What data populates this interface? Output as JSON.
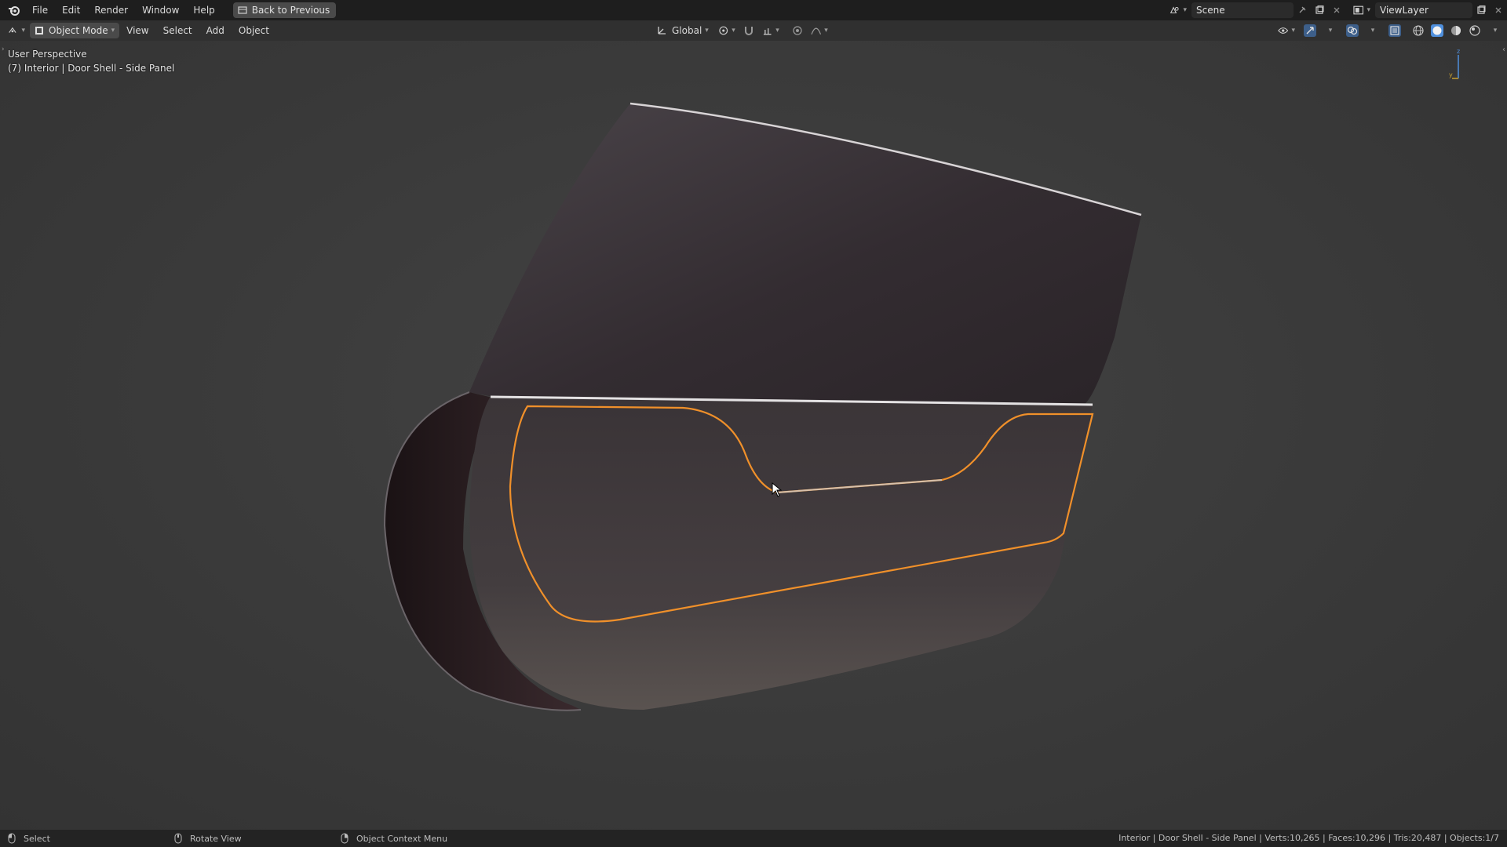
{
  "topbar": {
    "menus": [
      "File",
      "Edit",
      "Render",
      "Window",
      "Help"
    ],
    "back_button": "Back to Previous",
    "scene_name": "Scene",
    "view_layer": "ViewLayer"
  },
  "header": {
    "mode": "Object Mode",
    "menus": [
      "View",
      "Select",
      "Add",
      "Object"
    ],
    "transform_orientation": "Global"
  },
  "viewport": {
    "perspective_label": "User Perspective",
    "object_label": "(7) Interior | Door Shell - Side Panel",
    "gizmo_z": "z",
    "gizmo_y": "y"
  },
  "status": {
    "left_action": "Select",
    "middle_action": "Rotate View",
    "right_action": "Object Context Menu",
    "stats": "Interior | Door Shell - Side Panel | Verts:10,265 | Faces:10,296 | Tris:20,487 | Objects:1/7"
  },
  "colors": {
    "selection_outline": "#f0902a",
    "accent_blue": "#4f8fdc",
    "topbar_bg": "#1e1e1e",
    "header_bg": "#303030",
    "viewport_bg": "#3a3a3a"
  }
}
